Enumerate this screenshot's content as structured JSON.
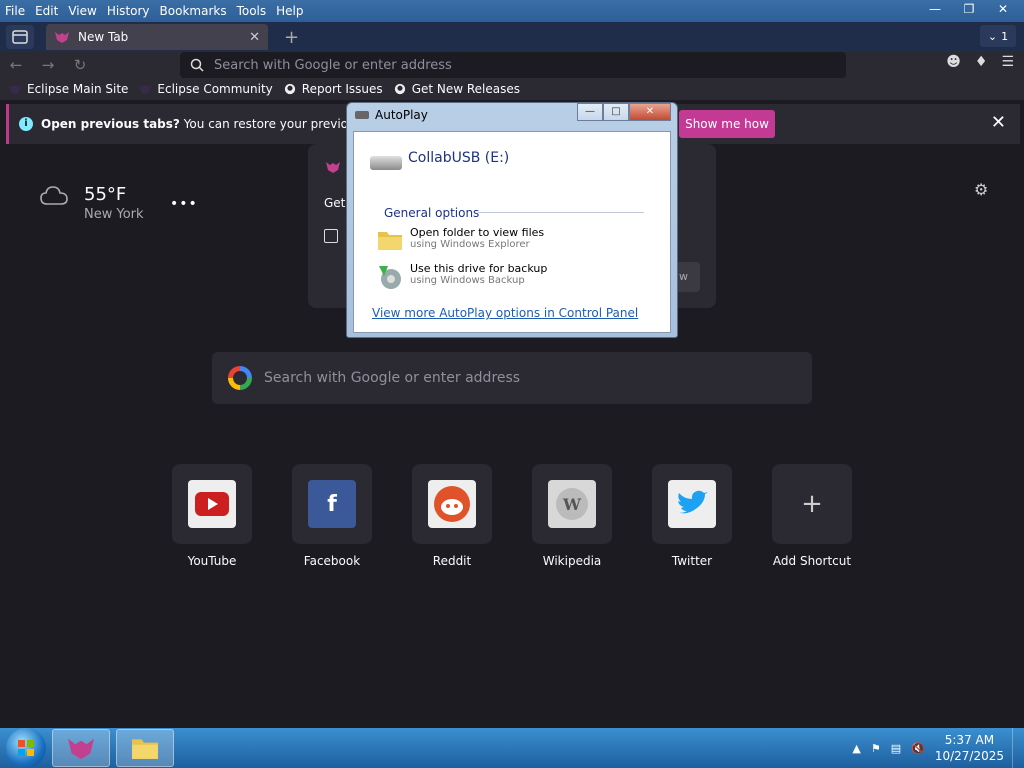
{
  "menu": {
    "items": [
      "File",
      "Edit",
      "View",
      "History",
      "Bookmarks",
      "Tools",
      "Help"
    ]
  },
  "tabs": {
    "active_title": "New Tab",
    "count": "1"
  },
  "urlbar": {
    "placeholder": "Search with Google or enter address"
  },
  "bookmarks": {
    "items": [
      "Eclipse Main Site",
      "Eclipse Community",
      "Report Issues",
      "Get New Releases"
    ]
  },
  "notification": {
    "bold": "Open previous tabs?",
    "text": " You can restore your previous sessio",
    "button": "Show me how"
  },
  "weather": {
    "temp": "55°F",
    "city": "New York"
  },
  "promo": {
    "get_text": "Get",
    "button_text": "w"
  },
  "search": {
    "placeholder": "Search with Google or enter address"
  },
  "shortcuts": [
    {
      "label": "YouTube",
      "color": "#cc1f1f"
    },
    {
      "label": "Facebook",
      "color": "#3b5998"
    },
    {
      "label": "Reddit",
      "color": "#e0522a"
    },
    {
      "label": "Wikipedia",
      "color": "#d8d8d8"
    },
    {
      "label": "Twitter",
      "color": "#1da1f2"
    },
    {
      "label": "Add Shortcut",
      "color": ""
    }
  ],
  "autoplay": {
    "title": "AutoPlay",
    "drive": "CollabUSB (E:)",
    "section": "General options",
    "options": [
      {
        "title": "Open folder to view files",
        "sub": "using Windows Explorer"
      },
      {
        "title": "Use this drive for backup",
        "sub": "using Windows Backup"
      }
    ],
    "link": "View more AutoPlay options in Control Panel"
  },
  "taskbar": {
    "time": "5:37 AM",
    "date": "10/27/2025"
  },
  "colors": {
    "accent": "#c23a94",
    "page_bg": "#1c1b22",
    "card_bg": "#2b2a33"
  }
}
